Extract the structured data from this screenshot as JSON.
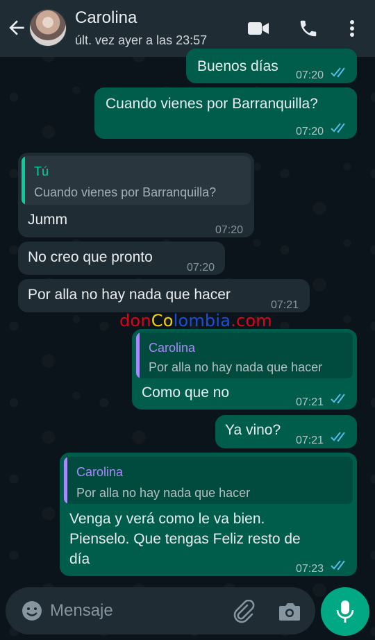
{
  "colors": {
    "header_bg": "#1f2c34",
    "chat_bg": "#0b141a",
    "outgoing_bubble": "#005c4b",
    "incoming_bubble": "#1f2c34",
    "read_ticks": "#53bdeb",
    "accent": "#00a884",
    "quote_name_self": "#06cf9c",
    "quote_name_contact": "#a78bfa"
  },
  "header": {
    "back_icon": "arrow-left-icon",
    "contact_name": "Carolina",
    "last_seen": "últ. vez ayer a las 23:57",
    "icons": [
      "video-camera-icon",
      "phone-icon",
      "more-vert-icon"
    ]
  },
  "messages": [
    {
      "direction": "out",
      "text": "Buenos días",
      "time": "07:20",
      "status": "read"
    },
    {
      "direction": "out",
      "text": "Cuando vienes por Barranquilla?",
      "time": "07:20",
      "status": "read"
    },
    {
      "direction": "in",
      "quote": {
        "author": "Tú",
        "text": "Cuando vienes por Barranquilla?"
      },
      "text": "Jumm",
      "time": "07:20"
    },
    {
      "direction": "in",
      "text": "No creo que pronto",
      "time": "07:20"
    },
    {
      "direction": "in",
      "text": "Por alla no hay nada que hacer",
      "time": "07:21"
    },
    {
      "direction": "out",
      "quote": {
        "author": "Carolina",
        "text": "Por alla no hay nada que hacer"
      },
      "text": "Como que no",
      "time": "07:21",
      "status": "read"
    },
    {
      "direction": "out",
      "text": "Ya vino?",
      "time": "07:21",
      "status": "read"
    },
    {
      "direction": "out",
      "quote": {
        "author": "Carolina",
        "text": "Por alla no hay nada que hacer"
      },
      "text_lines": [
        "Venga y verá como le va bien.",
        "Pienselo. Que tengas Feliz resto de",
        "día"
      ],
      "time": "07:23",
      "status": "read"
    }
  ],
  "watermark": {
    "part1": "don",
    "part2": "Co",
    "part3": "lombia",
    "part4": ".com"
  },
  "input": {
    "placeholder": "Mensaje",
    "icons": [
      "emoji-icon",
      "paperclip-icon",
      "camera-icon",
      "microphone-icon"
    ]
  }
}
